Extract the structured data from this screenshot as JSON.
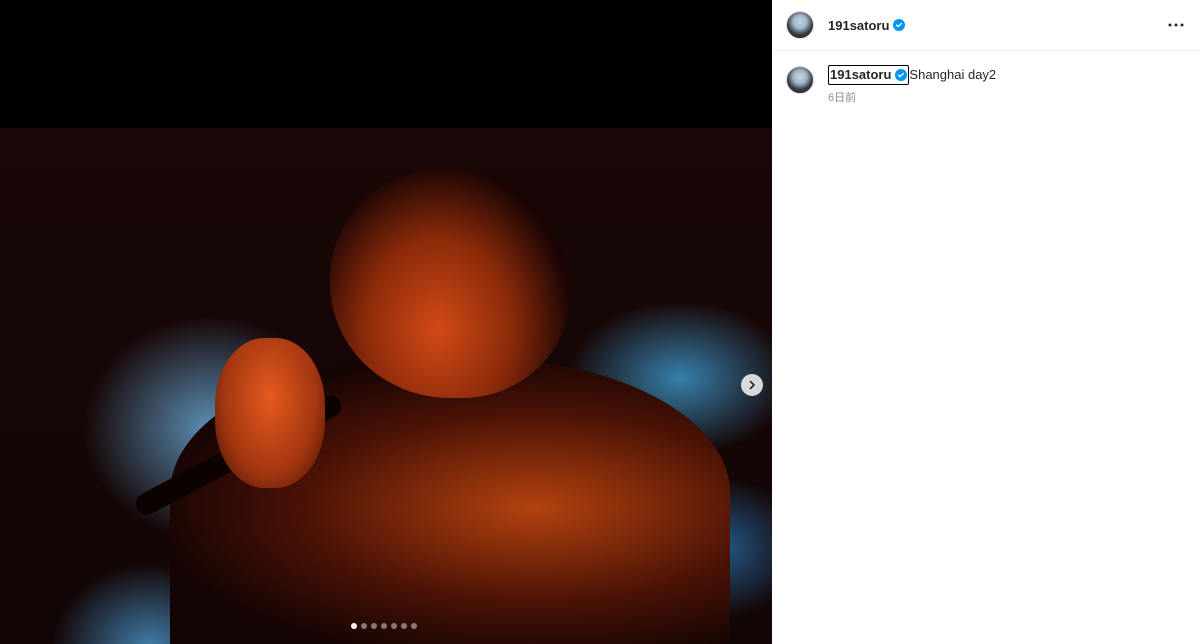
{
  "post": {
    "username": "191satoru",
    "caption": "Shanghai day2",
    "time": "6日前",
    "carousel": {
      "total": 7,
      "current": 1
    }
  },
  "icons": {
    "verified": "verified-badge-icon",
    "more": "more-options-icon",
    "next": "chevron-right-icon"
  },
  "colors": {
    "verified": "#0095f6",
    "text": "#262626",
    "muted": "#8e8e8e"
  }
}
